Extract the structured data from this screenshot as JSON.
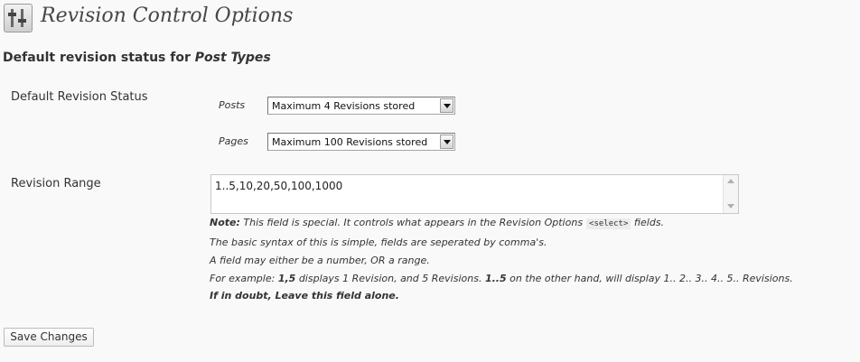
{
  "header": {
    "title": "Revision Control Options",
    "icon": "settings-sliders-icon"
  },
  "section": {
    "heading_prefix": "Default revision status for",
    "heading_emphasis": "Post Types"
  },
  "default_status": {
    "label": "Default Revision Status",
    "rows": [
      {
        "label": "Posts",
        "value": "Maximum 4 Revisions stored"
      },
      {
        "label": "Pages",
        "value": "Maximum 100 Revisions stored"
      }
    ]
  },
  "revision_range": {
    "label": "Revision Range",
    "value": "1..5,10,20,50,100,1000",
    "help": {
      "note_label": "Note:",
      "note_text": "This field is special. It controls what appears in the Revision Options",
      "note_code": "<select>",
      "note_suffix": "fields.",
      "line2": "The basic syntax of this is simple, fields are seperated by comma's.",
      "line3": "A field may either be a number, OR a range.",
      "line4_prefix": "For example:",
      "line4_example1": "1,5",
      "line4_mid": "displays 1 Revision, and 5 Revisions.",
      "line4_example2": "1..5",
      "line4_suffix": "on the other hand, will display 1.. 2.. 3.. 4.. 5.. Revisions.",
      "line5": "If in doubt, Leave this field alone."
    }
  },
  "actions": {
    "save_label": "Save Changes"
  }
}
